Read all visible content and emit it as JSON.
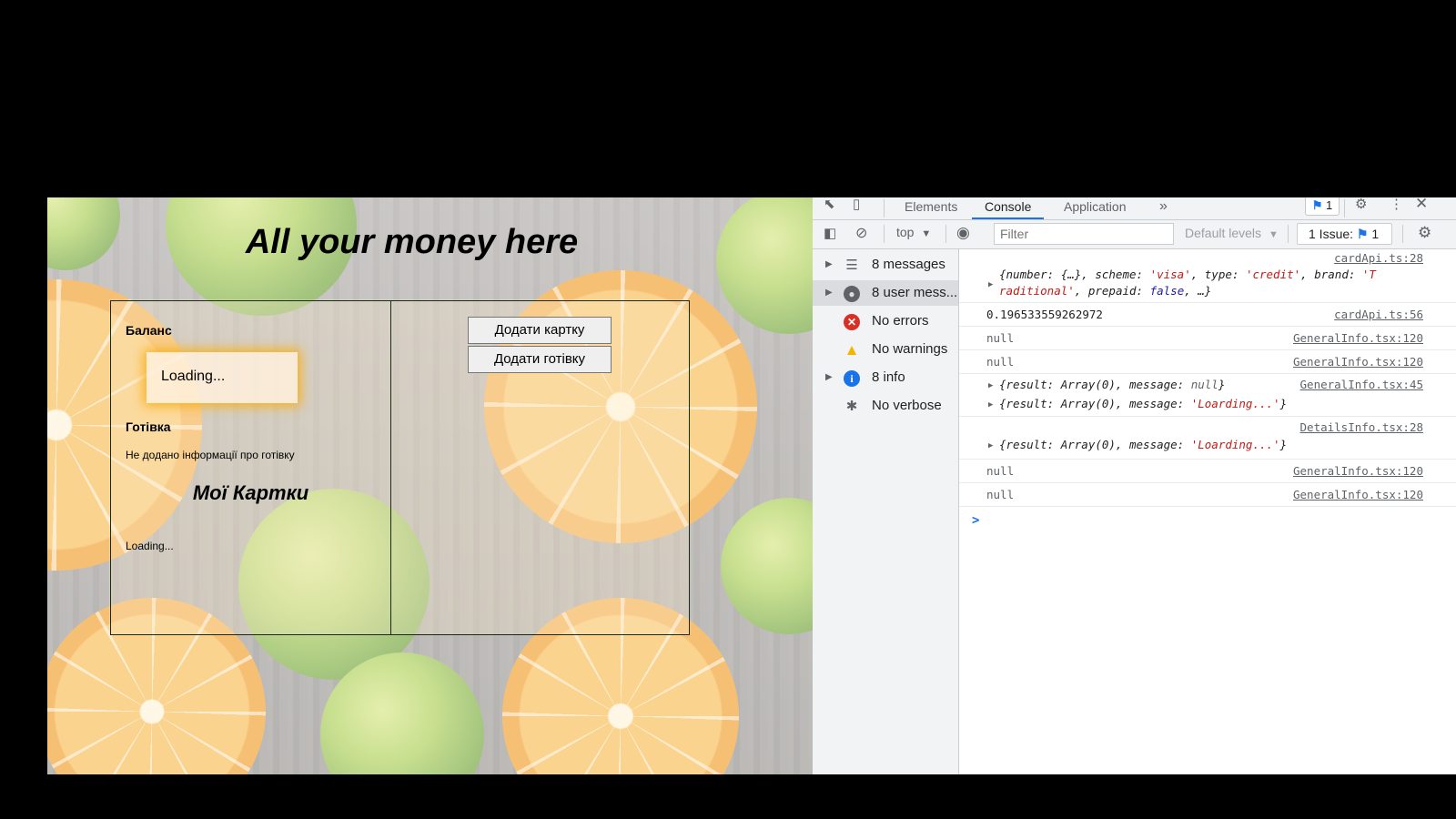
{
  "page": {
    "title": "All your money here",
    "balance_heading": "Баланс",
    "balance_loading": "Loading...",
    "cash_heading": "Готівка",
    "cash_text": "Не додано інформації про готівку",
    "cards_heading": "Мої Картки",
    "cards_loading": "Loading...",
    "add_card_button": "Додати картку",
    "add_cash_button": "Додати готівку"
  },
  "devtools": {
    "tabs": [
      "Elements",
      "Console",
      "Application"
    ],
    "active_tab": "Console",
    "more_tabs_icon": "»",
    "issue_badge_count": "1",
    "toolbar": {
      "context": "top",
      "filter_placeholder": "Filter",
      "levels": "Default levels",
      "issues_label": "1 Issue:",
      "issues_count": "1"
    },
    "sidebar": [
      {
        "label": "8 messages",
        "icon": "list-icon"
      },
      {
        "label": "8 user mess...",
        "icon": "user-icon"
      },
      {
        "label": "No errors",
        "icon": "error-icon"
      },
      {
        "label": "No warnings",
        "icon": "warning-icon"
      },
      {
        "label": "8 info",
        "icon": "info-icon"
      },
      {
        "label": "No verbose",
        "icon": "bug-icon"
      }
    ],
    "console": {
      "entries": [
        {
          "source": "cardApi.ts:28",
          "line1_a": "{number: {…}, scheme: ",
          "line1_b": "'visa'",
          "line1_c": ", type: ",
          "line1_d": "'credit'",
          "line1_e": ", brand: ",
          "line1_f": "'T",
          "line2_a": "raditional'",
          "line2_b": ", prepaid: ",
          "line2_c": "false",
          "line2_d": ", …}"
        },
        {
          "source": "cardApi.ts:56",
          "text": "0.196533559262972"
        },
        {
          "source": "GeneralInfo.tsx:120",
          "text": "null"
        },
        {
          "source": "GeneralInfo.tsx:120",
          "text": "null"
        },
        {
          "source": "GeneralInfo.tsx:45",
          "text_a": "{result: Array(0), message: ",
          "text_b": "null",
          "text_c": "}"
        },
        {
          "text_a": "{result: Array(0), message: ",
          "text_b": "'Loarding...'",
          "text_c": "}"
        },
        {
          "source": "DetailsInfo.tsx:28",
          "text_a": "{result: Array(0), message: ",
          "text_b": "'Loarding...'",
          "text_c": "}"
        },
        {
          "source": "GeneralInfo.tsx:120",
          "text": "null"
        },
        {
          "source": "GeneralInfo.tsx:120",
          "text": "null"
        }
      ],
      "prompt": ">"
    }
  }
}
